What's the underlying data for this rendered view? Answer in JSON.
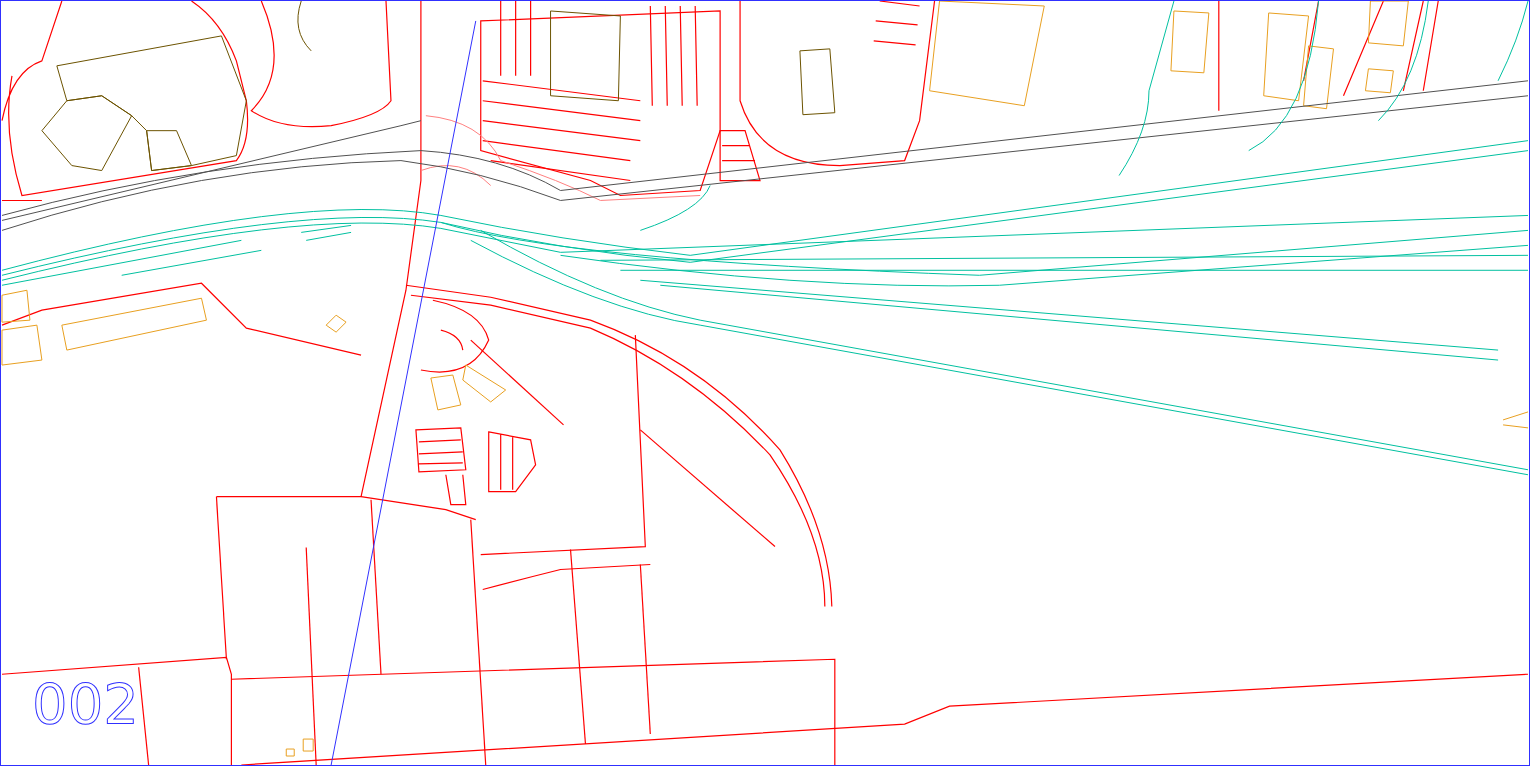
{
  "sheet": {
    "label": "002"
  }
}
